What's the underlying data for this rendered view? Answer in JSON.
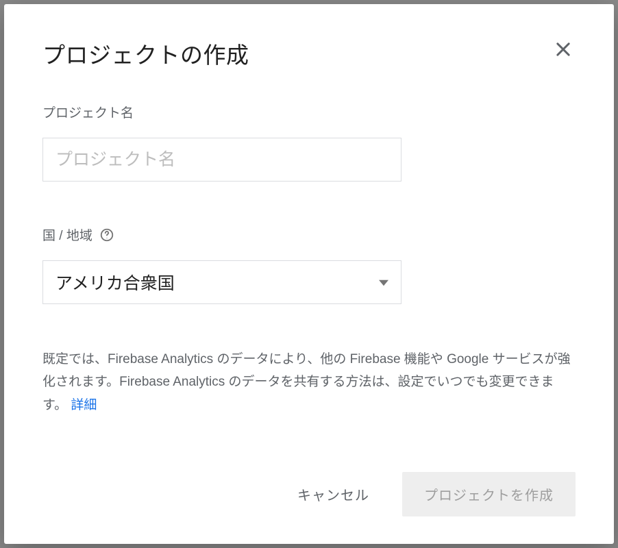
{
  "dialog": {
    "title": "プロジェクトの作成",
    "project_name": {
      "label": "プロジェクト名",
      "placeholder": "プロジェクト名",
      "value": ""
    },
    "country_region": {
      "label": "国 / 地域",
      "selected": "アメリカ合衆国"
    },
    "description": {
      "text": "既定では、Firebase Analytics のデータにより、他の Firebase 機能や Google サービスが強化されます。Firebase Analytics のデータを共有する方法は、設定でいつでも変更できます。",
      "link_label": "詳細"
    },
    "footer": {
      "cancel_label": "キャンセル",
      "create_label": "プロジェクトを作成"
    }
  }
}
